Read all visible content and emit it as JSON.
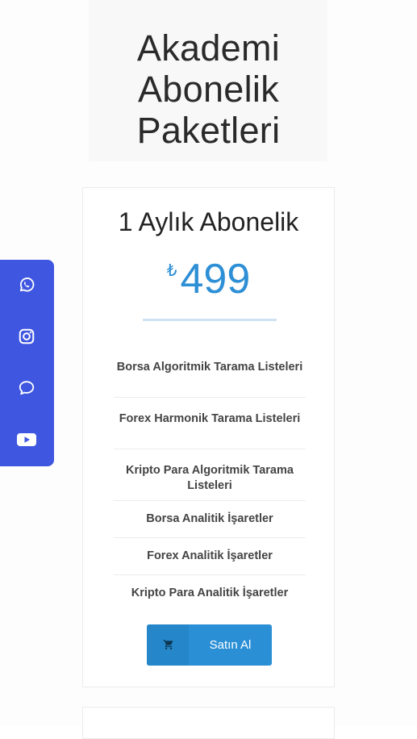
{
  "page": {
    "title_lines": [
      "Akademi",
      "Abonelik",
      "Paketleri"
    ]
  },
  "plan": {
    "name": "1 Aylık Abonelik",
    "currency": "₺",
    "price": "499",
    "features": [
      "Borsa Algoritmik Tarama Listeleri",
      "Forex Harmonik Tarama Listeleri",
      "Kripto Para Algoritmik Tarama Listeleri",
      "Borsa Analitik İşaretler",
      "Forex Analitik İşaretler",
      "Kripto Para Analitik İşaretler"
    ],
    "buy_label": "Satın Al"
  },
  "social": {
    "icons": [
      "whatsapp-icon",
      "instagram-icon",
      "chat-icon",
      "youtube-icon"
    ]
  },
  "colors": {
    "accent": "#2b8fd6",
    "social_bar": "#3f56e0"
  }
}
